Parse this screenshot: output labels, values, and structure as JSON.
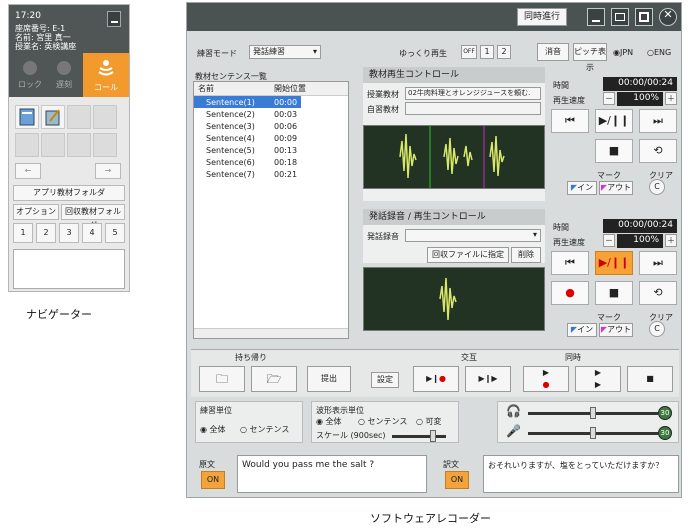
{
  "navigator": {
    "time": "17:20",
    "seat_label": "座席番号: E-1",
    "name_label": "名前: 宮里 真一",
    "class_label": "授業名: 英検講座",
    "tabs": [
      {
        "label": "ロック"
      },
      {
        "label": "遅刻"
      },
      {
        "label": "コール"
      }
    ],
    "app_folder_button": "アプリ教材フォルダ",
    "option_button": "オプション",
    "collect_folder_button": "回収教材フォルダ",
    "numbers": [
      "1",
      "2",
      "3",
      "4",
      "5"
    ],
    "arrow_left": "←",
    "arrow_right": "→",
    "caption": "ナビゲーター"
  },
  "recorder": {
    "caption": "ソフトウェアレコーダー",
    "sync_button": "同時進行",
    "practice_mode_label": "練習モード",
    "practice_mode_value": "発話練習",
    "slow_play_label": "ゆっくり再生",
    "slow_off": "OFF",
    "slow_1": "1",
    "slow_2": "2",
    "mute_button": "消音",
    "pitch_button": "ピッチ表示",
    "lang_jpn": "JPN",
    "lang_eng": "ENG",
    "sentence_list_label": "教材センテンス一覧",
    "col_name": "名前",
    "col_start": "開始位置",
    "sentences": [
      {
        "name": "Sentence(1)",
        "start": "00:00"
      },
      {
        "name": "Sentence(2)",
        "start": "00:03"
      },
      {
        "name": "Sentence(3)",
        "start": "00:06"
      },
      {
        "name": "Sentence(4)",
        "start": "00:09"
      },
      {
        "name": "Sentence(5)",
        "start": "00:13"
      },
      {
        "name": "Sentence(6)",
        "start": "00:18"
      },
      {
        "name": "Sentence(7)",
        "start": "00:21"
      }
    ],
    "material_panel_title": "教材再生コントロール",
    "class_material_label": "授業教材",
    "class_material_value": "02牛肉料理とオレンジジュースを頼む.",
    "self_material_label": "自習教材",
    "time_label": "時間",
    "time_value_1": "00:00/00:24",
    "speed_label": "再生速度",
    "speed_value_1": "100%",
    "minus": "－",
    "plus": "＋",
    "mark_label": "マーク",
    "clear_label": "クリア",
    "in_label": "イン",
    "out_label": "アウト",
    "clear_btn": "C",
    "record_panel_title": "発話録音 / 再生コントロール",
    "record_label": "発話録音",
    "collect_file_button": "回収ファイルに指定",
    "delete_button": "削除",
    "time_value_2": "00:00/00:24",
    "speed_value_2": "100%",
    "bring_label": "持ち帰り",
    "submit_button": "提出",
    "settings_button": "設定",
    "alternate_label": "交互",
    "simultaneous_label": "同時",
    "practice_unit_label": "練習単位",
    "unit_all": "全体",
    "unit_sentence": "センテンス",
    "wave_unit_label": "波形表示単位",
    "wave_all": "全体",
    "wave_sentence": "センテンス",
    "wave_variable": "可変",
    "scale_label": "スケール (900sec)",
    "vol_1": "30",
    "vol_2": "30",
    "original_label": "原文",
    "translation_label": "訳文",
    "on_label": "ON",
    "original_text": "Would you pass me the salt ?",
    "translation_text": "おそれいりますが、塩をとっていただけますか？"
  }
}
